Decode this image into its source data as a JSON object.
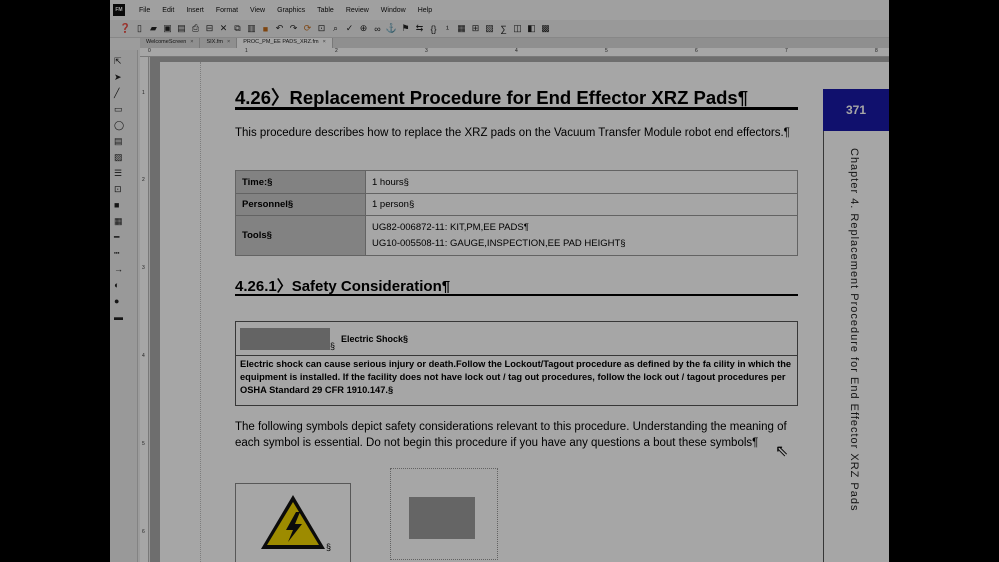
{
  "app": {
    "logo_text": "FM",
    "menus": [
      "File",
      "Edit",
      "Insert",
      "Format",
      "View",
      "Graphics",
      "Table",
      "Review",
      "Window",
      "Help"
    ]
  },
  "tabs": [
    {
      "label": "WelcomeScreen",
      "close": "×"
    },
    {
      "label": "SIX.fm",
      "close": "×"
    },
    {
      "label": "PROC_PM_EE PADS_XRZ.fm",
      "close": "×"
    }
  ],
  "ruler": {
    "marks": [
      "0",
      "1",
      "2",
      "3",
      "4",
      "5",
      "6",
      "7",
      "8"
    ]
  },
  "vruler": {
    "marks": [
      "1",
      "2",
      "3",
      "4",
      "5",
      "6"
    ]
  },
  "document": {
    "heading": "4.26〉Replacement Procedure for End Effector XRZ Pads¶",
    "intro": "This procedure describes how to replace the XRZ pads on the Vacuum Transfer Module robot end effectors.¶",
    "table": {
      "time_label": "Time:§",
      "time_value": "1 hours§",
      "personnel_label": "Personnel§",
      "personnel_value": "1 person§",
      "tools_label": "Tools§",
      "tools_value_1": "UG82-006872-11: KIT,PM,EE PADS¶",
      "tools_value_2": "UG10-005508-11: GAUGE,INSPECTION,EE PAD HEIGHT§"
    },
    "safety_heading": "4.26.1〉Safety Consideration¶",
    "warning": {
      "title": "Electric Shock§",
      "section_mark": "§",
      "body": "Electric shock can cause serious injury or death.Follow the Lockout/Tagout procedure as defined by the fa cility in which the equipment is installed. If the facility does not have lock out / tag out procedures, follow the lock out / tagout procedures per OSHA Standard 29 CFR 1910.147.§"
    },
    "symbols_para": "The following symbols depict safety considerations relevant to this procedure. Understanding the meaning of each symbol is essential. Do not begin this procedure if you have any questions a bout these symbols¶",
    "symbol_section_mark": "§"
  },
  "sidebar": {
    "page_number": "371",
    "chapter_text": "Chapter 4. Replacement Procedure for End Effector XRZ Pads"
  },
  "colors": {
    "page_tab_blue": "#1a1aa8",
    "table_label_gray": "#c8c8c8",
    "warning_yellow": "#f2d600"
  }
}
